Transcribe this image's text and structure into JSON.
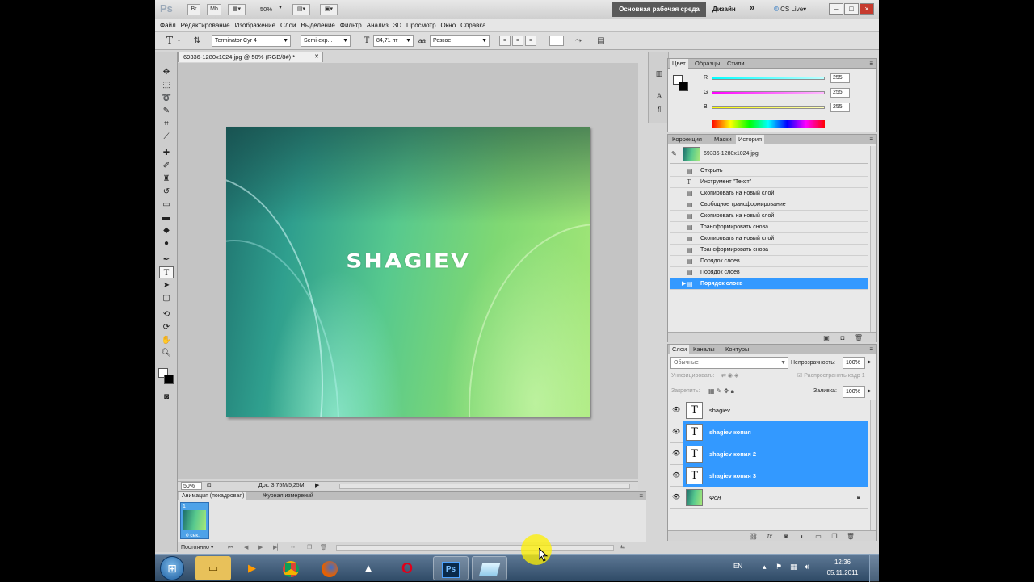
{
  "appbar": {
    "logo": "Ps",
    "btn_br": "Br",
    "btn_mb": "Mb",
    "zoom": "50%",
    "workspace_active": "Основная рабочая среда",
    "workspace_design": "Дизайн",
    "overflow": "»",
    "cslive": "CS Live",
    "win_min": "–",
    "win_max": "□",
    "win_close": "×"
  },
  "menu": [
    "Файл",
    "Редактирование",
    "Изображение",
    "Слои",
    "Выделение",
    "Фильтр",
    "Анализ",
    "3D",
    "Просмотр",
    "Окно",
    "Справка"
  ],
  "options": {
    "font_family": "Terminator Cyr 4",
    "font_style": "Semi-exp...",
    "font_size": "84,71 пт",
    "aa_label": "aa",
    "antialias": "Резкое"
  },
  "document": {
    "tab_title": "69336-1280x1024.jpg @ 50% (RGB/8#) *",
    "canvas_text": "SHAGIEV"
  },
  "status": {
    "zoom": "50%",
    "doc": "Док: 3,75M/5,25M"
  },
  "animation": {
    "tabs": [
      "Анимация (покадровая)",
      "Журнал измерений"
    ],
    "frame_number": "1",
    "frame_delay": "0 сек.",
    "loop": "Постоянно"
  },
  "color_panel": {
    "tabs": [
      "Цвет",
      "Образцы",
      "Стили"
    ],
    "channels": [
      {
        "label": "R",
        "value": "255",
        "color": "#00ffff"
      },
      {
        "label": "G",
        "value": "255",
        "color": "#ff00ff"
      },
      {
        "label": "B",
        "value": "255",
        "color": "#ffff00"
      }
    ]
  },
  "history_panel": {
    "tabs": [
      "Коррекция",
      "Маски",
      "История"
    ],
    "snapshot": "69336-1280x1024.jpg",
    "items": [
      "Открыть",
      "Инструмент \"Текст\"",
      "Скопировать на новый слой",
      "Свободное трансформирование",
      "Скопировать на новый слой",
      "Трансформировать снова",
      "Скопировать на новый слой",
      "Трансформировать снова",
      "Порядок слоев",
      "Порядок слоев",
      "Порядок слоев"
    ],
    "selected_index": 10
  },
  "layers_panel": {
    "tabs": [
      "Слои",
      "Каналы",
      "Контуры"
    ],
    "blend_mode": "Обычные",
    "opacity_label": "Непрозрачность:",
    "opacity": "100%",
    "unify_label": "Унифицировать:",
    "propagate_label": "Распространить кадр 1",
    "lock_label": "Закрепить:",
    "fill_label": "Заливка:",
    "fill": "100%",
    "layers": [
      {
        "name": "shagiev",
        "selected": false
      },
      {
        "name": "shagiev копия",
        "selected": true
      },
      {
        "name": "shagiev копия 2",
        "selected": true
      },
      {
        "name": "shagiev копия 3",
        "selected": true
      }
    ],
    "background": "Фон"
  },
  "taskbar": {
    "lang": "EN",
    "time": "12:36",
    "date": "05.11.2011"
  }
}
